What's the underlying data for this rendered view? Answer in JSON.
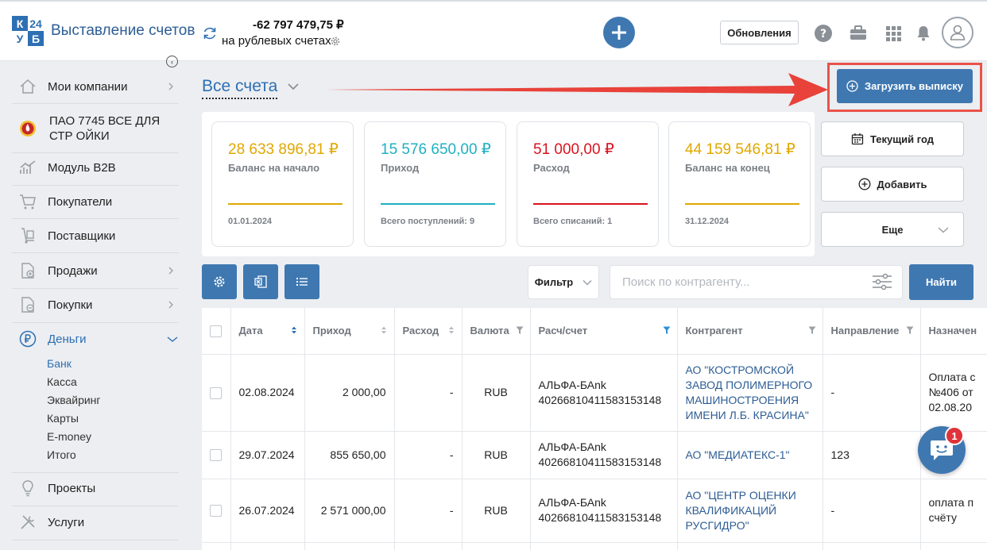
{
  "app": {
    "logo_letters": [
      "К",
      "24",
      "У",
      "Б"
    ],
    "title": "Выставление счетов",
    "balance_amount": "-62 797 479,75 ₽",
    "balance_caption": "на рублевых счетах",
    "updates_label": "Обновления"
  },
  "sidebar": {
    "items": [
      {
        "label": "Мои компании"
      },
      {
        "label": "ПАО 7745 ВСЕ ДЛЯ СТР ОЙКИ"
      },
      {
        "label": "Модуль B2B"
      },
      {
        "label": "Покупатели"
      },
      {
        "label": "Поставщики"
      },
      {
        "label": "Продажи"
      },
      {
        "label": "Покупки"
      },
      {
        "label": "Деньги"
      },
      {
        "label": "Проекты"
      },
      {
        "label": "Услуги"
      }
    ],
    "money_subitems": [
      "Банк",
      "Касса",
      "Эквайринг",
      "Карты",
      "E-money",
      "Итого"
    ]
  },
  "main": {
    "title": "Все счета",
    "upload_label": "Загрузить выписку",
    "cards": [
      {
        "amount": "28 633 896,81 ₽",
        "caption": "Баланс на начало",
        "footer": "01.01.2024",
        "color": "#e0a800"
      },
      {
        "amount": "15 576 650,00 ₽",
        "caption": "Приход",
        "footer": "Всего поступлений: 9",
        "color": "#1fb0c2"
      },
      {
        "amount": "51 000,00 ₽",
        "caption": "Расход",
        "footer": "Всего списаний: 1",
        "color": "#d9131e"
      },
      {
        "amount": "44 159 546,81 ₽",
        "caption": "Баланс на конец",
        "footer": "31.12.2024",
        "color": "#e0a800"
      }
    ],
    "period_label": "Текущий год",
    "add_label": "Добавить",
    "more_label": "Еще",
    "filter_label": "Фильтр",
    "search_placeholder": "Поиск по контрагенту...",
    "find_label": "Найти"
  },
  "table": {
    "headers": [
      "Дата",
      "Приход",
      "Расход",
      "Валюта",
      "Расч/счет",
      "Контрагент",
      "Направление",
      "Назначен"
    ],
    "rows": [
      {
        "date": "02.08.2024",
        "income": "2 000,00",
        "expense": "-",
        "currency": "RUB",
        "account_bank": "АЛЬФА-БАnk",
        "account_no": "40266810411583153148",
        "counterparty": "АО \"КОСТРОМСКОЙ ЗАВОД ПОЛИМЕРНОГО МАШИНОСТРОЕНИЯ ИМЕНИ Л.Б. КРАСИНА\"",
        "direction": "-",
        "purpose": "Оплата с №406 от 02.08.20"
      },
      {
        "date": "29.07.2024",
        "income": "855 650,00",
        "expense": "-",
        "currency": "RUB",
        "account_bank": "АЛЬФА-БАnk",
        "account_no": "40266810411583153148",
        "counterparty": "АО \"МЕДИАТЕКС-1\"",
        "direction": "123",
        "purpose": ""
      },
      {
        "date": "26.07.2024",
        "income": "2 571 000,00",
        "expense": "-",
        "currency": "RUB",
        "account_bank": "АЛЬФА-БАnk",
        "account_no": "40266810411583153148",
        "counterparty": "АО \"ЦЕНТР ОЦЕНКИ КВАЛИФИКАЦИЙ РУСГИДРО\"",
        "direction": "-",
        "purpose": "оплата п счёту"
      }
    ]
  },
  "chat": {
    "badge": "1"
  }
}
